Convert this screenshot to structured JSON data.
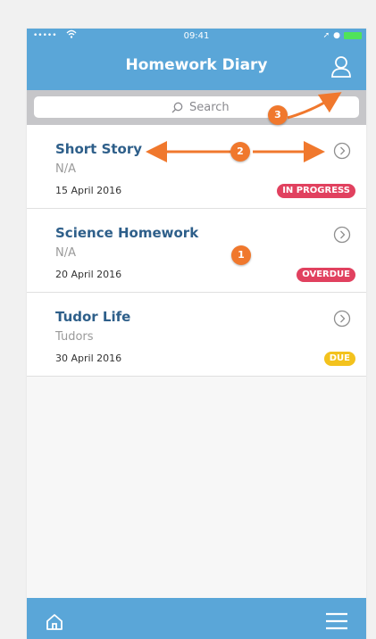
{
  "status_bar": {
    "signal": "•••••",
    "time": "09:41"
  },
  "header": {
    "title": "Homework Diary"
  },
  "search": {
    "placeholder": "Search"
  },
  "items": [
    {
      "title": "Short Story",
      "subject": "N/A",
      "date": "15 April 2016",
      "status": "IN PROGRESS"
    },
    {
      "title": "Science Homework",
      "subject": "N/A",
      "date": "20 April 2016",
      "status": "OVERDUE"
    },
    {
      "title": "Tudor Life",
      "subject": "Tudors",
      "date": "30 April 2016",
      "status": "DUE"
    }
  ],
  "callouts": [
    "1",
    "2",
    "3"
  ],
  "colors": {
    "header": "#5aa6d8",
    "title_text": "#2e5f8a",
    "badge_red": "#e1415f",
    "badge_yellow": "#f3c21d",
    "callout": "#f0782d"
  },
  "icons": [
    "wifi-icon",
    "battery-icon",
    "profile-icon",
    "search-icon",
    "chevron-right-icon",
    "home-icon",
    "menu-icon"
  ]
}
